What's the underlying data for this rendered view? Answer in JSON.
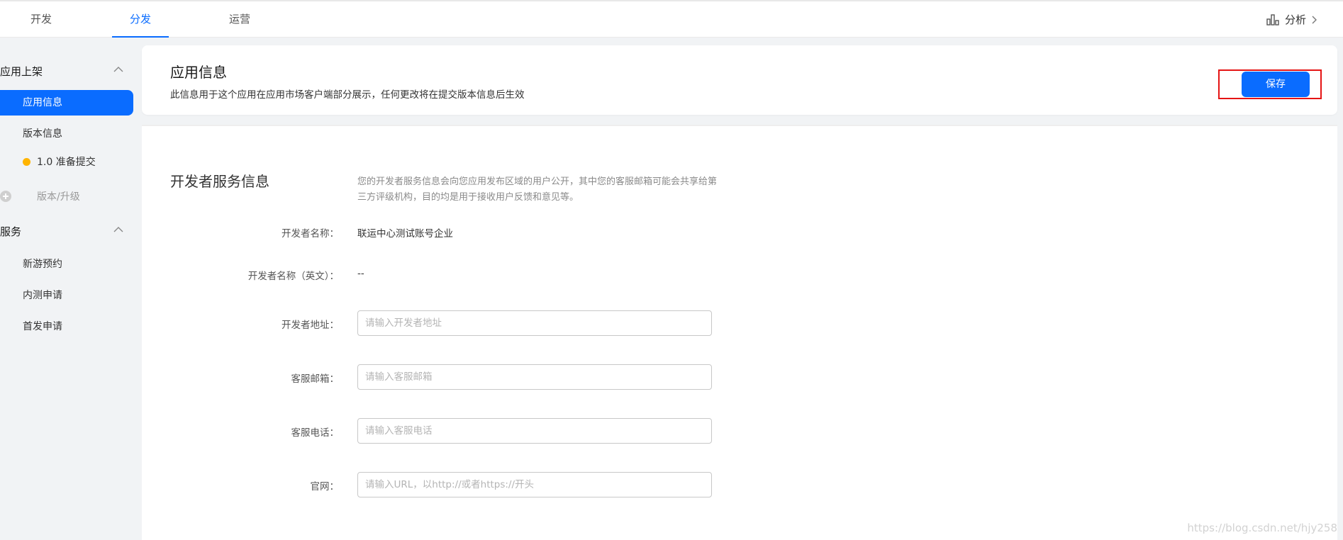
{
  "tabs": [
    {
      "label": "开发"
    },
    {
      "label": "分发"
    },
    {
      "label": "运营"
    }
  ],
  "analysis": {
    "label": "分析"
  },
  "sidebar": {
    "group_app": "应用上架",
    "item_app_info": "应用信息",
    "item_version_info": "版本信息",
    "item_version_status": "1.0 准备提交",
    "item_upgrade": "版本/升级",
    "group_service": "服务",
    "item_new_game": "新游预约",
    "item_beta": "内测申请",
    "item_launch": "首发申请"
  },
  "header": {
    "title": "应用信息",
    "description": "此信息用于这个应用在应用市场客户端部分展示，任何更改将在提交版本信息后生效",
    "save_label": "保存"
  },
  "developer_section": {
    "title": "开发者服务信息",
    "note": "您的开发者服务信息会向您应用发布区域的用户公开，其中您的客服邮箱可能会共享给第三方评级机构，目的均是用于接收用户反馈和意见等。",
    "name_label": "开发者名称：",
    "name_value": "联运中心测试账号企业",
    "name_en_label": "开发者名称（英文）：",
    "name_en_value": "--",
    "address_label": "开发者地址：",
    "address_placeholder": "请输入开发者地址",
    "email_label": "客服邮箱：",
    "email_placeholder": "请输入客服邮箱",
    "phone_label": "客服电话：",
    "phone_placeholder": "请输入客服电话",
    "website_label": "官网：",
    "website_placeholder": "请输入URL，以http://或者https://开头"
  },
  "watermark": "https://blog.csdn.net/hjy258",
  "colors": {
    "accent": "#0a6cff",
    "highlight_border": "#e51414",
    "status_dot": "#ffb400"
  }
}
